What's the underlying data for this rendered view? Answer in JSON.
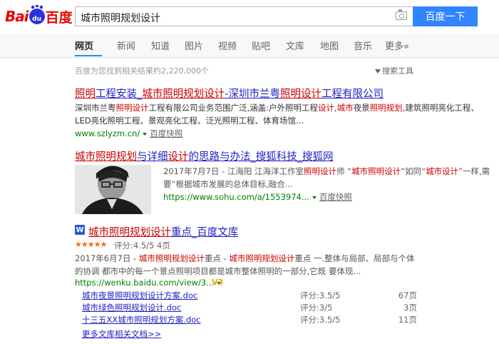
{
  "logo": {
    "part1": "Bai",
    "paw_text": "du",
    "part2": "百度"
  },
  "search": {
    "query": "城市照明规划设计",
    "button_label": "百度一下"
  },
  "tabs": [
    "网页",
    "新闻",
    "知道",
    "图片",
    "视频",
    "贴吧",
    "文库",
    "地图",
    "音乐",
    "更多»"
  ],
  "meta": {
    "result_count_text": "百度为您找到相关结果约2,220,000个",
    "tools_label": "搜索工具"
  },
  "results": [
    {
      "title_parts": [
        {
          "t": "照明",
          "h": true
        },
        {
          "t": "工程安装_",
          "h": false
        },
        {
          "t": "城市照明规划设计",
          "h": true
        },
        {
          "t": "-深圳市兰粤",
          "h": false
        },
        {
          "t": "照明设计",
          "h": true
        },
        {
          "t": "工程有限公司",
          "h": false
        }
      ],
      "abstract_parts": [
        {
          "t": "深圳市兰粤",
          "h": false
        },
        {
          "t": "照明设计",
          "h": true
        },
        {
          "t": "工程有限公司业务范围广泛,涵盖:户外照明工程",
          "h": false
        },
        {
          "t": "设计",
          "h": true
        },
        {
          "t": ",",
          "h": false
        },
        {
          "t": "城市",
          "h": true
        },
        {
          "t": "夜景",
          "h": false
        },
        {
          "t": "照明规划",
          "h": true
        },
        {
          "t": ",建筑照明亮化工程、LED亮化照明工程、景观亮化工程、泛光照明工程、体育场馆...",
          "h": false
        }
      ],
      "url": "www.szlyzm.cn/",
      "snapshot": "百度快照"
    },
    {
      "title_parts": [
        {
          "t": "城市照明规划",
          "h": true
        },
        {
          "t": "与详细",
          "h": false
        },
        {
          "t": "设计",
          "h": true
        },
        {
          "t": "的思路与办法_搜狐科技_搜狐网",
          "h": false
        }
      ],
      "abstract_parts": [
        {
          "t": "2017年7月7日 - 江海阳 江海洋工作室",
          "h": false
        },
        {
          "t": "照明设计",
          "h": true
        },
        {
          "t": "师 “",
          "h": false
        },
        {
          "t": "城市照明设计",
          "h": true
        },
        {
          "t": "”如同“",
          "h": false
        },
        {
          "t": "城市设计",
          "h": true
        },
        {
          "t": "”一样,需要“根据城市发展的总体目标,融合...",
          "h": false
        }
      ],
      "url": "https://www.sohu.com/a/1553974...",
      "snapshot": "百度快照"
    },
    {
      "doc_icon": "W",
      "title_parts": [
        {
          "t": "城市照明规划设计",
          "h": true
        },
        {
          "t": "重点_百度文库",
          "h": false
        }
      ],
      "stars": "★★★★★",
      "rating": "评分:4.5/5 4页",
      "abstract_parts": [
        {
          "t": "2017年6月7日 - ",
          "h": false
        },
        {
          "t": "城市照明规划设计",
          "h": true
        },
        {
          "t": "重点 - ",
          "h": false
        },
        {
          "t": "城市照明规划设计",
          "h": true
        },
        {
          "t": "重点 一.整体与局部、局部与个体的协调 都市中的每一个景点照明项目都是城市整体照明的一部分,它既 要体现...",
          "h": false
        }
      ],
      "url": "https://wenku.baidu.com/view/3...",
      "v_badge": "V3",
      "docs": [
        {
          "name": "城市夜景照明规划设计方案.doc",
          "rating": "评分:3.5/5",
          "pages": "67页"
        },
        {
          "name": "城市绿色照明规划设计.doc",
          "rating": "评分:3/5",
          "pages": "3页"
        },
        {
          "name": "十三五XX城市照明规划方案.doc",
          "rating": "评分:3.5/5",
          "pages": "11页"
        }
      ],
      "more_docs": "更多文库相关文档>>"
    }
  ],
  "colors": {
    "accent": "#3385ff",
    "link": "#2121c4",
    "highlight": "#cc0000",
    "url": "#008000"
  }
}
